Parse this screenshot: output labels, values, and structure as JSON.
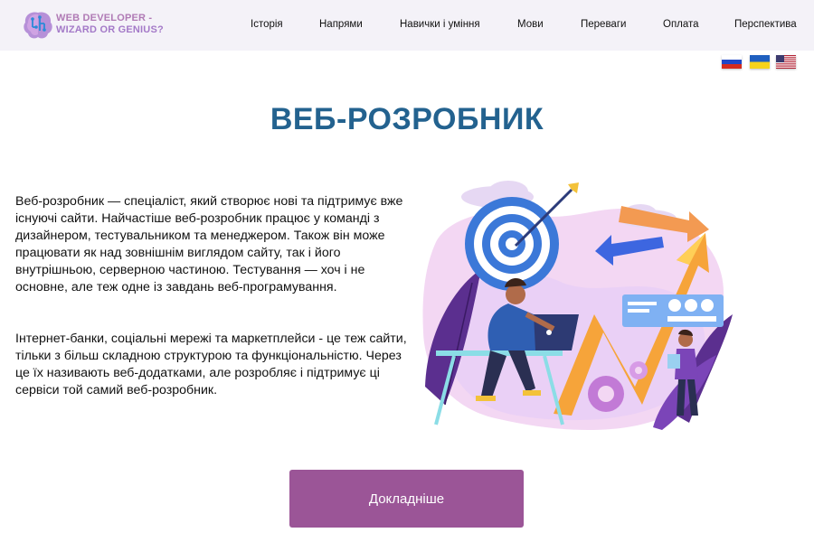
{
  "brand": {
    "line1": "WEB DEVELOPER -",
    "line2": "WIZARD OR GENIUS?"
  },
  "nav": [
    "Історія",
    "Напрями",
    "Навички і уміння",
    "Мови",
    "Переваги",
    "Оплата",
    "Перспектива"
  ],
  "flags": [
    {
      "name": "russia-flag-icon",
      "colors": [
        "#ffffff",
        "#1f47c7",
        "#d52b1e"
      ]
    },
    {
      "name": "ukraine-flag-icon",
      "colors": [
        "#1f5fbf",
        "#f6d31b"
      ]
    },
    {
      "name": "usa-flag-icon",
      "colors": [
        "#b22234",
        "#ffffff",
        "#3c3b6e"
      ]
    }
  ],
  "page": {
    "title": "ВЕБ-РОЗРОБНИК",
    "paragraph1": "Веб-розробник — спеціаліст, який створює нові та підтримує вже існуючі сайти. Найчастіше веб-розробник працює у команді з дизайнером, тестувальником та менеджером. Також він може працювати як над зовнішнім виглядом сайту, так і його внутрішньою, серверною частиною. Тестування — хоч і не основне, але теж одне із завдань веб-програмування.",
    "paragraph2": "Інтернет-банки, соціальні мережі та маркетплейси - це теж сайти, тільки з більш складною структурою та функціональністю. Через це їх називають веб-додатками, але розробляє і підтримує ці сервіси той самий веб-розробник.",
    "button": "Докладніше"
  },
  "colors": {
    "title": "#23628f",
    "button": "#9b5597",
    "header_bg": "#f4f2f8"
  }
}
